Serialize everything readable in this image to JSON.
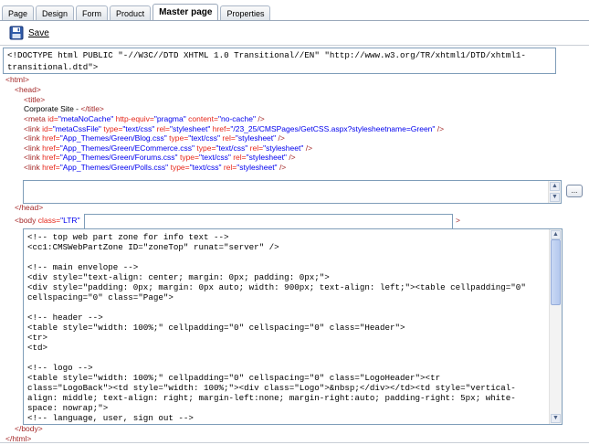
{
  "tabs": [
    {
      "label": "Page"
    },
    {
      "label": "Design"
    },
    {
      "label": "Form"
    },
    {
      "label": "Product"
    },
    {
      "label": "Master page"
    },
    {
      "label": "Properties"
    }
  ],
  "active_tab": "Master page",
  "toolbar": {
    "save_label": "Save"
  },
  "doctype_value": "<!DOCTYPE html PUBLIC \"-//W3C//DTD XHTML 1.0 Transitional//EN\" \"http://www.w3.org/TR/xhtml1/DTD/xhtml1-transitional.dtd\">",
  "markup": {
    "html_open": "<html>",
    "head_open": "<head>",
    "title_open": "<title>",
    "title_text": "Corporate Site - ",
    "title_close": "</title>",
    "head_close": "</head>",
    "body_open_prefix": "<body",
    "body_attr_name": "class=",
    "body_attr_value": "\"LTR\"",
    "body_gt": ">",
    "body_close": "</body>",
    "html_close": "</html>",
    "head_lines": [
      {
        "tag": "<meta",
        "parts": [
          [
            "id=",
            "\"metaNoCache\""
          ],
          [
            "http-equiv=",
            "\"pragma\""
          ],
          [
            "content=",
            "\"no-cache\""
          ]
        ],
        "end": " />"
      },
      {
        "tag": "<link",
        "parts": [
          [
            "id=",
            "\"metaCssFile\""
          ],
          [
            "type=",
            "\"text/css\""
          ],
          [
            "rel=",
            "\"stylesheet\""
          ],
          [
            "href=",
            "\"/23_25/CMSPages/GetCSS.aspx?stylesheetname=Green\""
          ]
        ],
        "end": " />"
      },
      {
        "tag": "<link",
        "parts": [
          [
            "href=",
            "\"App_Themes/Green/Blog.css\""
          ],
          [
            "type=",
            "\"text/css\""
          ],
          [
            "rel=",
            "\"stylesheet\""
          ]
        ],
        "end": " />"
      },
      {
        "tag": "<link",
        "parts": [
          [
            "href=",
            "\"App_Themes/Green/ECommerce.css\""
          ],
          [
            "type=",
            "\"text/css\""
          ],
          [
            "rel=",
            "\"stylesheet\""
          ]
        ],
        "end": " />"
      },
      {
        "tag": "<link",
        "parts": [
          [
            "href=",
            "\"App_Themes/Green/Forums.css\""
          ],
          [
            "type=",
            "\"text/css\""
          ],
          [
            "rel=",
            "\"stylesheet\""
          ]
        ],
        "end": " />"
      },
      {
        "tag": "<link",
        "parts": [
          [
            "href=",
            "\"App_Themes/Green/Polls.css\""
          ],
          [
            "type=",
            "\"text/css\""
          ],
          [
            "rel=",
            "\"stylesheet\""
          ]
        ],
        "end": " />"
      }
    ]
  },
  "head_textarea_value": "",
  "dots_button_label": "...",
  "body_class_value": "",
  "code_lines": [
    "<!-- top web part zone for info text -->",
    "<cc1:CMSWebPartZone ID=\"zoneTop\" runat=\"server\" />",
    "",
    "<!-- main envelope -->",
    "<div style=\"text-align: center; margin: 0px; padding: 0px;\">",
    "<div style=\"padding: 0px; margin: 0px auto; width: 900px; text-align: left;\"><table cellpadding=\"0\"",
    "cellspacing=\"0\" class=\"Page\">",
    "",
    "<!-- header -->",
    "<table style=\"width: 100%;\" cellpadding=\"0\" cellspacing=\"0\" class=\"Header\">",
    "<tr>",
    "<td>",
    "",
    "<!-- logo -->",
    "<table style=\"width: 100%;\" cellpadding=\"0\" cellspacing=\"0\" class=\"LogoHeader\"><tr",
    "class=\"LogoBack\"><td style=\"width: 100%;\"><div class=\"Logo\">&nbsp;</div></td><td style=\"vertical-",
    "align: middle; text-align: right; margin-left:none; margin-right:auto; padding-right: 5px; white-",
    "space: nowrap;\">",
    "<!-- language, user, sign out -->"
  ],
  "colors": {
    "tag": "#a52a2a",
    "attr_name": "#e6271b",
    "attr_value": "#0000ee",
    "border": "#7f9db9"
  }
}
